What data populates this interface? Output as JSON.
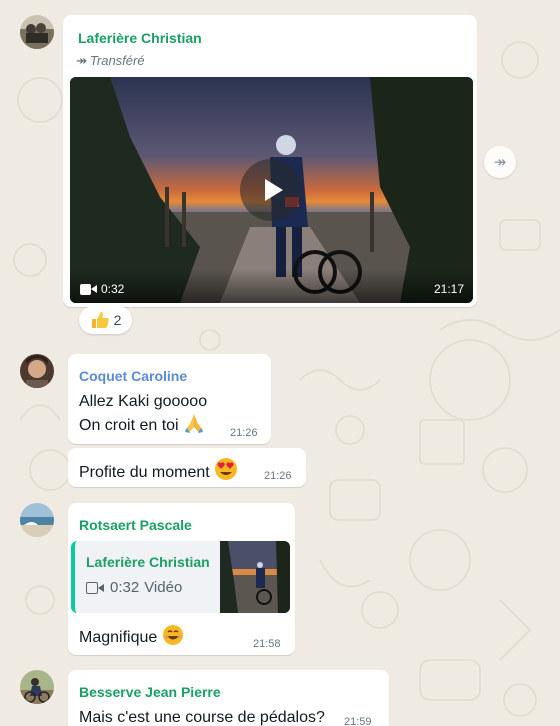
{
  "colors": {
    "chat_background": "#efeae2",
    "bubble": "#ffffff",
    "sender_green": "#1aa064",
    "sender_blue": "#5a8cd6",
    "meta_gray": "#667781"
  },
  "messages": [
    {
      "type": "forwarded-video",
      "sender": "Laferière Christian",
      "forwarded_label": "Transféré",
      "video": {
        "duration": "0:32",
        "time": "21:17"
      },
      "reaction": {
        "emoji": "thumbs-up",
        "count": "2"
      }
    },
    {
      "type": "text",
      "sender": "Coquet Caroline",
      "lines": [
        "Allez Kaki gooooo",
        "On croit en toi"
      ],
      "emoji": "folded-hands",
      "time": "21:26"
    },
    {
      "type": "text",
      "text": "Profite du moment",
      "emoji": "heart-eyes",
      "time": "21:26"
    },
    {
      "type": "reply",
      "sender": "Rotsaert Pascale",
      "quoted": {
        "author": "Laferière Christian",
        "duration": "0:32",
        "kind": "Vidéo"
      },
      "text": "Magnifique",
      "emoji": "smiling-face",
      "time": "21:58"
    },
    {
      "type": "text",
      "sender": "Besserve Jean Pierre",
      "text": "Mais c'est une course de pédalos?",
      "time": "21:59"
    }
  ]
}
